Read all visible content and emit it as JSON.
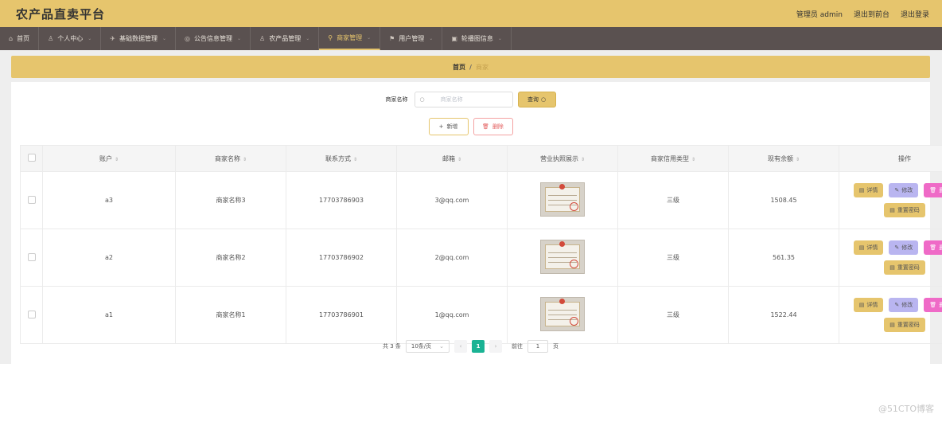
{
  "header": {
    "title": "农产品直卖平台",
    "admin_label": "管理员 admin",
    "back_front": "退出到前台",
    "logout": "退出登录"
  },
  "nav": [
    {
      "icon": "home-icon",
      "glyph": "⌂",
      "label": "首页",
      "dropdown": false
    },
    {
      "icon": "user-icon",
      "glyph": "♙",
      "label": "个人中心",
      "dropdown": true
    },
    {
      "icon": "send-icon",
      "glyph": "✈",
      "label": "基础数据管理",
      "dropdown": true
    },
    {
      "icon": "bell-icon",
      "glyph": "◎",
      "label": "公告信息管理",
      "dropdown": true
    },
    {
      "icon": "person-icon",
      "glyph": "♙",
      "label": "农产品管理",
      "dropdown": true
    },
    {
      "icon": "pin-icon",
      "glyph": "⚲",
      "label": "商家管理",
      "dropdown": true,
      "active": true
    },
    {
      "icon": "flag-icon",
      "glyph": "⚑",
      "label": "用户管理",
      "dropdown": true
    },
    {
      "icon": "image-icon",
      "glyph": "▣",
      "label": "轮播图信息",
      "dropdown": true
    }
  ],
  "breadcrumb": {
    "home": "首页",
    "separator": "/",
    "current": "商家"
  },
  "search": {
    "label": "商家名称",
    "placeholder": "商家名称",
    "button": "查询"
  },
  "actions": {
    "add": "新增",
    "delete": "删除"
  },
  "table": {
    "columns": [
      "账户",
      "商家名称",
      "联系方式",
      "邮箱",
      "营业执照展示",
      "商家信用类型",
      "现有余额",
      "操作"
    ],
    "rows": [
      {
        "account": "a3",
        "name": "商家名称3",
        "phone": "17703786903",
        "email": "3@qq.com",
        "credit": "三级",
        "balance": "1508.45"
      },
      {
        "account": "a2",
        "name": "商家名称2",
        "phone": "17703786902",
        "email": "2@qq.com",
        "credit": "三级",
        "balance": "561.35"
      },
      {
        "account": "a1",
        "name": "商家名称1",
        "phone": "17703786901",
        "email": "1@qq.com",
        "credit": "三级",
        "balance": "1522.44"
      }
    ],
    "ops": {
      "detail": "详情",
      "edit": "修改",
      "delete": "删除",
      "reset": "重置密码"
    }
  },
  "pagination": {
    "total": "共 3 条",
    "page_size": "10条/页",
    "current_page": "1",
    "goto_label": "前往",
    "goto_value": "1",
    "page_unit": "页"
  },
  "watermark": "@51CTO博客",
  "colors": {
    "accent": "#e6c56d",
    "nav_bg": "#5a5150",
    "active_page": "#1ab394",
    "delete": "#ef6ac7",
    "edit": "#b9b5f0"
  }
}
